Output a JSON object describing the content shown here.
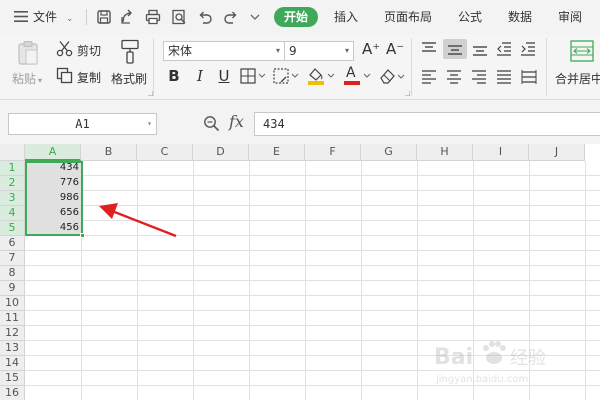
{
  "menubar": {
    "file_label": "文件",
    "tabs": [
      {
        "label": "插入"
      },
      {
        "label": "页面布局"
      },
      {
        "label": "公式"
      },
      {
        "label": "数据"
      },
      {
        "label": "审阅"
      }
    ],
    "active_tab": "开始"
  },
  "ribbon": {
    "paste_label": "粘贴",
    "cut_label": "剪切",
    "copy_label": "复制",
    "format_painter_label": "格式刷",
    "font_name": "宋体",
    "font_size": "9",
    "grow_font": "A⁺",
    "shrink_font": "A⁻",
    "bold": "B",
    "italic": "I",
    "underline": "U",
    "font_color_glyph": "A",
    "merge_center_label": "合并居中"
  },
  "formula_bar": {
    "cell_ref": "A1",
    "fx_label": "fx",
    "formula": "434"
  },
  "grid": {
    "columns": [
      "A",
      "B",
      "C",
      "D",
      "E",
      "F",
      "G",
      "H",
      "I",
      "J"
    ],
    "rows": [
      "1",
      "2",
      "3",
      "4",
      "5",
      "6",
      "7",
      "8",
      "9",
      "10",
      "11",
      "12",
      "13",
      "14",
      "15",
      "16"
    ],
    "cells_a": [
      "434",
      "776",
      "986",
      "656",
      "456"
    ],
    "selected_column": "A"
  },
  "watermark": {
    "brand": "Bai",
    "suffix": "经验",
    "url": "jingyan.baidu.com"
  },
  "colors": {
    "accent": "#3fa95a",
    "arrow": "#e02020",
    "font_color_bar": "#e02020",
    "fill_color_bar": "#f0c000"
  }
}
